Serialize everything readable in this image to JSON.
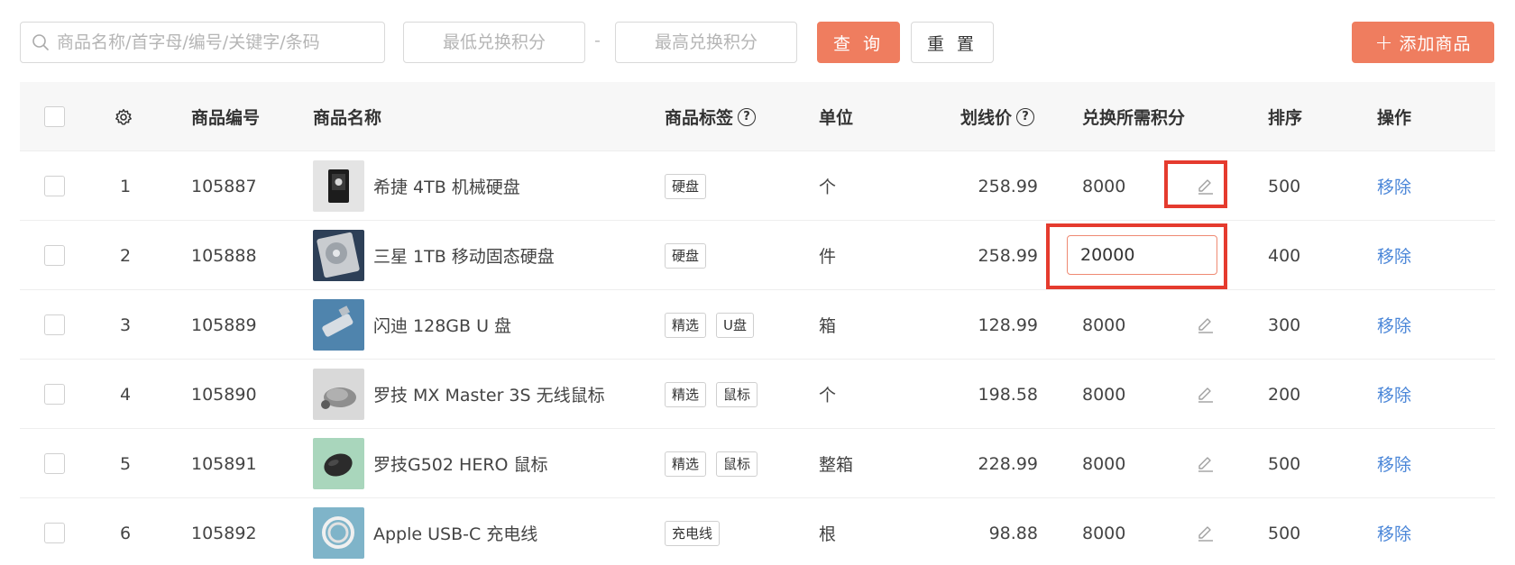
{
  "toolbar": {
    "search_placeholder": "商品名称/首字母/编号/关键字/条码",
    "min_points_placeholder": "最低兑换积分",
    "range_separator": "-",
    "max_points_placeholder": "最高兑换积分",
    "query_label": "查 询",
    "reset_label": "重 置",
    "add_label": "添加商品",
    "accent_color": "#ef7d5f"
  },
  "table": {
    "columns": {
      "code": "商品编号",
      "name": "商品名称",
      "tags": "商品标签",
      "unit": "单位",
      "price": "划线价",
      "points": "兑换所需积分",
      "sort": "排序",
      "action": "操作"
    },
    "rows": [
      {
        "index": "1",
        "code": "105887",
        "name": "希捷 4TB 机械硬盘",
        "tags": [
          "硬盘"
        ],
        "unit": "个",
        "price": "258.99",
        "points": "8000",
        "sort": "500",
        "action": "移除",
        "image": "hdd-black"
      },
      {
        "index": "2",
        "code": "105888",
        "name": "三星 1TB 移动固态硬盘",
        "tags": [
          "硬盘"
        ],
        "unit": "件",
        "price": "258.99",
        "points_editing": "20000",
        "sort": "400",
        "action": "移除",
        "image": "hdd-silver"
      },
      {
        "index": "3",
        "code": "105889",
        "name": "闪迪 128GB U 盘",
        "tags": [
          "精选",
          "U盘"
        ],
        "unit": "箱",
        "price": "128.99",
        "points": "8000",
        "sort": "300",
        "action": "移除",
        "image": "usb-drive"
      },
      {
        "index": "4",
        "code": "105890",
        "name": "罗技 MX Master 3S 无线鼠标",
        "tags": [
          "精选",
          "鼠标"
        ],
        "unit": "个",
        "price": "198.58",
        "points": "8000",
        "sort": "200",
        "action": "移除",
        "image": "mouse-grey"
      },
      {
        "index": "5",
        "code": "105891",
        "name": "罗技G502 HERO 鼠标",
        "tags": [
          "精选",
          "鼠标"
        ],
        "unit": "整箱",
        "price": "228.99",
        "points": "8000",
        "sort": "500",
        "action": "移除",
        "image": "mouse-black"
      },
      {
        "index": "6",
        "code": "105892",
        "name": "Apple USB-C 充电线",
        "tags": [
          "充电线"
        ],
        "unit": "根",
        "price": "98.88",
        "points": "8000",
        "sort": "500",
        "action": "移除",
        "image": "usb-cable"
      }
    ]
  }
}
